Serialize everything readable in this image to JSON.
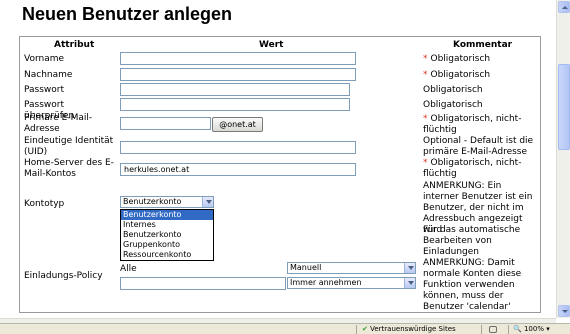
{
  "page": {
    "title": "Neuen Benutzer anlegen"
  },
  "table": {
    "headers": {
      "attribute": "Attribut",
      "value": "Wert",
      "comment": "Kommentar"
    },
    "rows": {
      "vorname": {
        "label": "Vorname",
        "value": "",
        "comment": "Obligatorisch",
        "required": true
      },
      "nachname": {
        "label": "Nachname",
        "value": "",
        "comment": "Obligatorisch",
        "required": true
      },
      "passwort": {
        "label": "Passwort",
        "value": "",
        "comment": "Obligatorisch",
        "required": false
      },
      "passwort_check": {
        "label": "Passwort überprüfen",
        "value": "",
        "comment": "Obligatorisch",
        "required": false
      },
      "email": {
        "label": "Primäre E-Mail-Adresse",
        "value": "",
        "domain": "@onet.at",
        "comment": "Obligatorisch, nicht-flüchtig",
        "required": true
      },
      "identity": {
        "label": "Eindeutige Identität (UID)",
        "value": "",
        "comment": "Optional - Default ist die primäre E-Mail-Adresse",
        "required": false
      },
      "homeserver": {
        "label": "Home-Server des E-Mail-Kontos",
        "value": "herkules.onet.at",
        "comment": "Obligatorisch, nicht-flüchtig",
        "required": true
      },
      "kontotyp": {
        "label": "Kontotyp",
        "selected": "Benutzerkonto",
        "options": [
          "Benutzerkonto",
          "Internes Benutzerkonto",
          "Gruppenkonto",
          "Ressourcenkonto"
        ],
        "comment": "ANMERKUNG: Ein interner Benutzer ist ein Benutzer, der nicht im Adressbuch angezeigt wird"
      },
      "einladung": {
        "label": "Einladungs-Policy",
        "scope": "Alle",
        "mode": "Manuell",
        "value": "",
        "action": "Immer annehmen",
        "comment1": "Für das automatische Bearbeiten von Einladungen",
        "comment2": "ANMERKUNG: Damit normale Konten diese Funktion verwenden können, muss der Benutzer 'calendar' Zugriff auf den Kalender-Ordner"
      }
    }
  },
  "status_bar": {
    "trusted_label": "Vertrauenswürdige Sites",
    "zoom": "100%"
  },
  "colors": {
    "required_star": "#e0301e",
    "selected_option": "#316ac5"
  }
}
